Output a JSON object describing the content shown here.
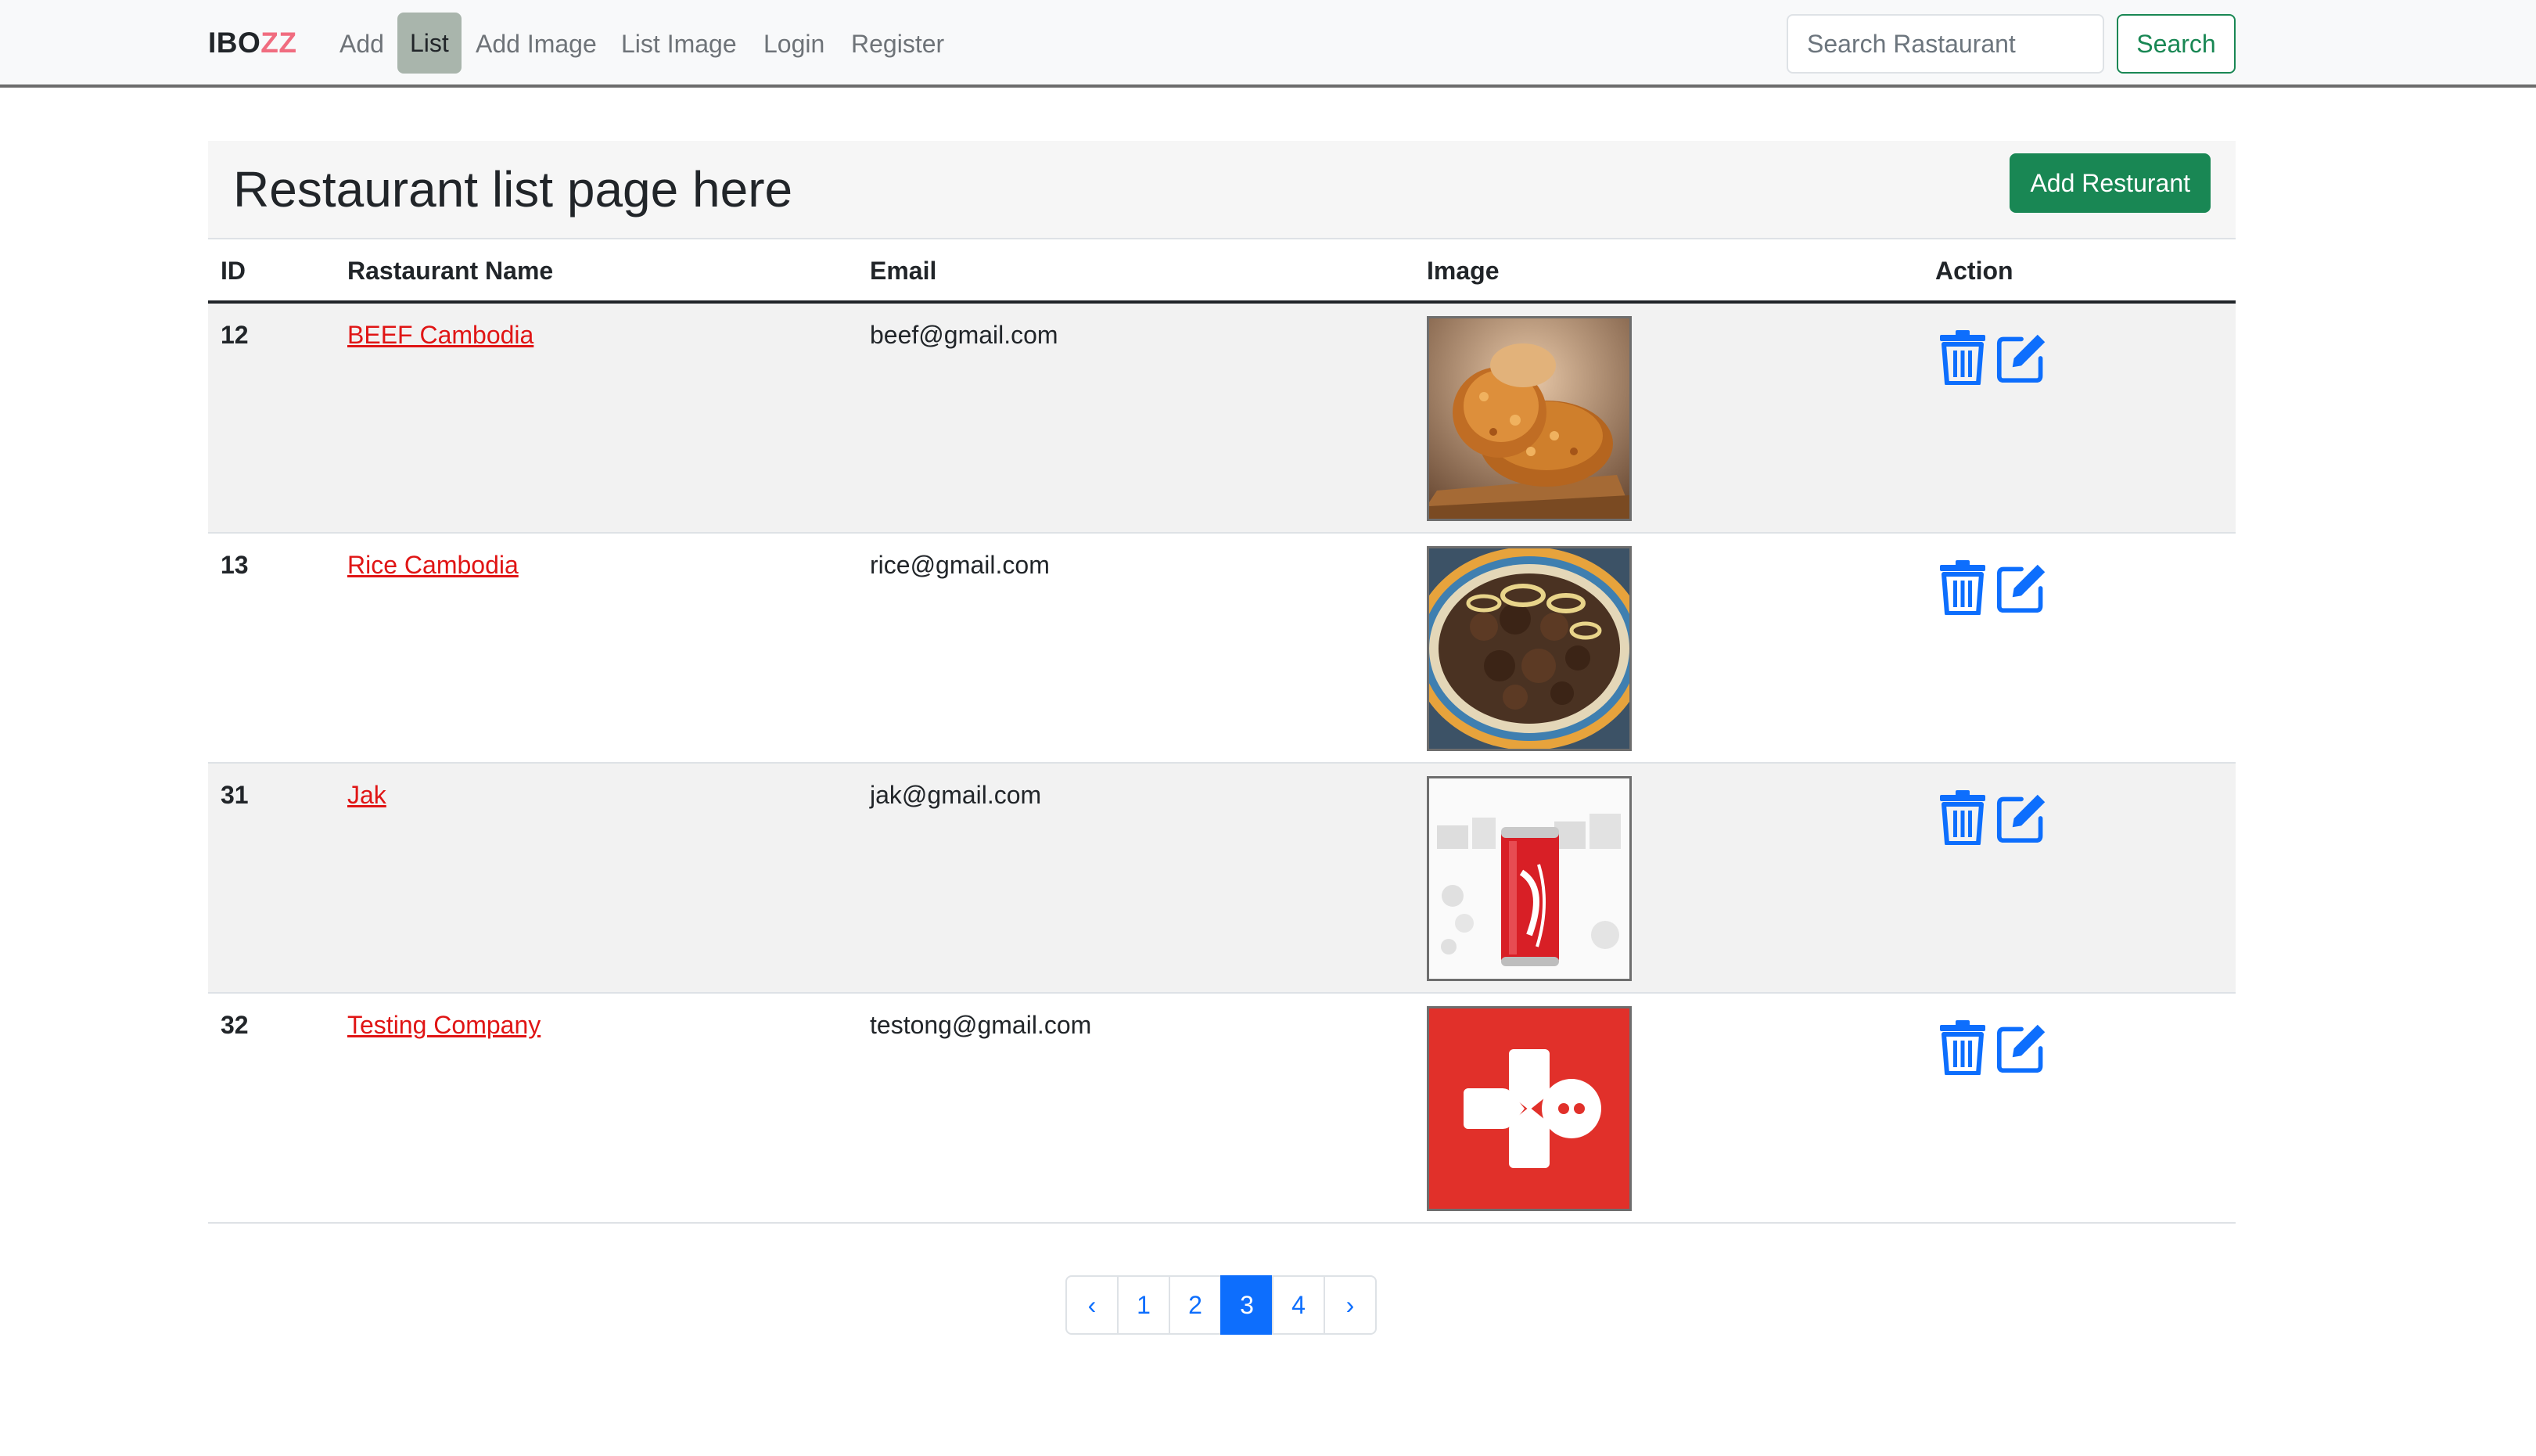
{
  "navbar": {
    "brand_part1": "IBO",
    "brand_part2": "ZZ",
    "links": [
      "Add",
      "List",
      "Add Image",
      "List Image",
      "Login",
      "Register"
    ],
    "active_link": "List",
    "search_placeholder": "Search Rastaurant",
    "search_button": "Search"
  },
  "header": {
    "title": "Restaurant list page here",
    "add_button": "Add Resturant"
  },
  "table": {
    "columns": [
      "ID",
      "Rastaurant Name",
      "Email",
      "Image",
      "Action"
    ],
    "rows": [
      {
        "id": "12",
        "name": "BEEF Cambodia",
        "email": "beef@gmail.com",
        "image": "fried-chicken"
      },
      {
        "id": "13",
        "name": "Rice Cambodia",
        "email": "rice@gmail.com",
        "image": "beef-stir-fry"
      },
      {
        "id": "31",
        "name": "Jak",
        "email": "jak@gmail.com",
        "image": "coca-cola-can"
      },
      {
        "id": "32",
        "name": "Testing Company",
        "email": "testong@gmail.com",
        "image": "red-game-logo"
      }
    ],
    "action_icons": [
      "trash-icon",
      "edit-icon"
    ]
  },
  "pagination": {
    "prev": "‹",
    "pages": [
      "1",
      "2",
      "3",
      "4"
    ],
    "current": "3",
    "next": "›"
  },
  "colors": {
    "brand_accent": "#f06c7f",
    "link_red": "#e01515",
    "primary_blue": "#0d6efd",
    "success_green": "#198754",
    "active_nav_bg": "#a9b5ac"
  }
}
